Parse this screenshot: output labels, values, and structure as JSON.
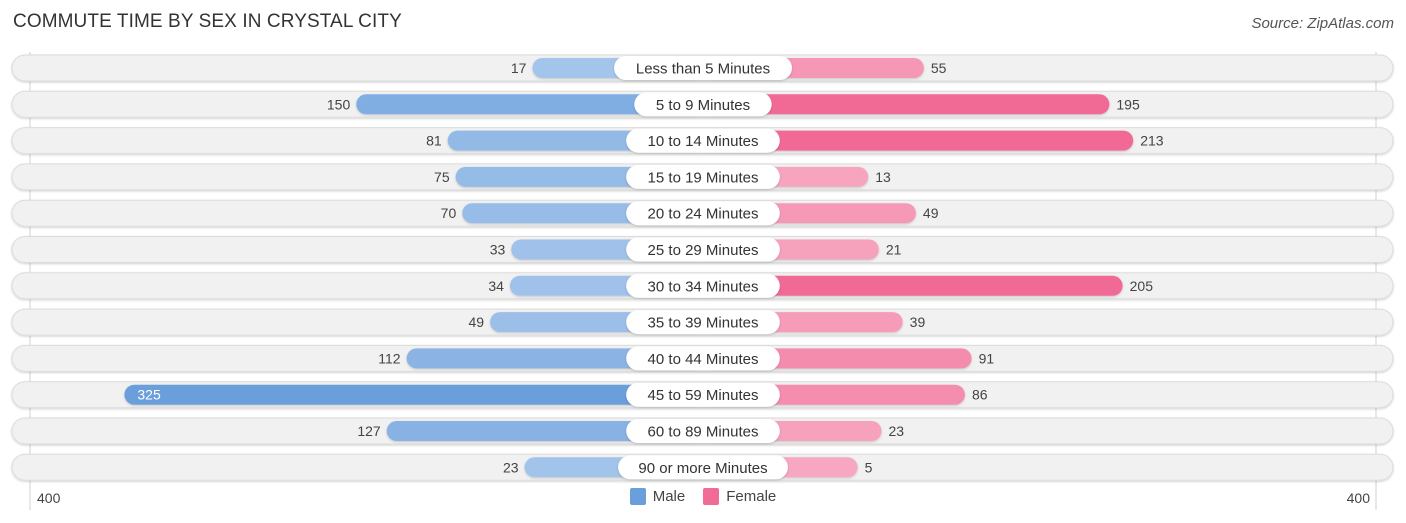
{
  "title": "COMMUTE TIME BY SEX IN CRYSTAL CITY",
  "source": "Source: ZipAtlas.com",
  "colors": {
    "male": "#6a9fdc",
    "male_light": "#a9c8ec",
    "female": "#f06b95",
    "female_light": "#f7a9c2",
    "track": "#f1f1f1",
    "track_border": "#dcdcdc",
    "label_bg": "#ffffff"
  },
  "legend": [
    {
      "name": "Male",
      "color": "#6a9fdc"
    },
    {
      "name": "Female",
      "color": "#f06b95"
    }
  ],
  "axis": {
    "left_label": "400",
    "right_label": "400"
  },
  "chart_data": {
    "type": "bar",
    "orientation": "horizontal-diverging",
    "title": "COMMUTE TIME BY SEX IN CRYSTAL CITY",
    "categories": [
      "Less than 5 Minutes",
      "5 to 9 Minutes",
      "10 to 14 Minutes",
      "15 to 19 Minutes",
      "20 to 24 Minutes",
      "25 to 29 Minutes",
      "30 to 34 Minutes",
      "35 to 39 Minutes",
      "40 to 44 Minutes",
      "45 to 59 Minutes",
      "60 to 89 Minutes",
      "90 or more Minutes"
    ],
    "series": [
      {
        "name": "Male",
        "side": "left",
        "values": [
          17,
          150,
          81,
          75,
          70,
          33,
          34,
          49,
          112,
          325,
          127,
          23
        ]
      },
      {
        "name": "Female",
        "side": "right",
        "values": [
          55,
          195,
          213,
          13,
          49,
          21,
          205,
          39,
          91,
          86,
          23,
          5
        ]
      }
    ],
    "xlim": [
      0,
      400
    ],
    "xlabel": "",
    "ylabel": "",
    "legend_position": "bottom-center",
    "grid": false
  }
}
